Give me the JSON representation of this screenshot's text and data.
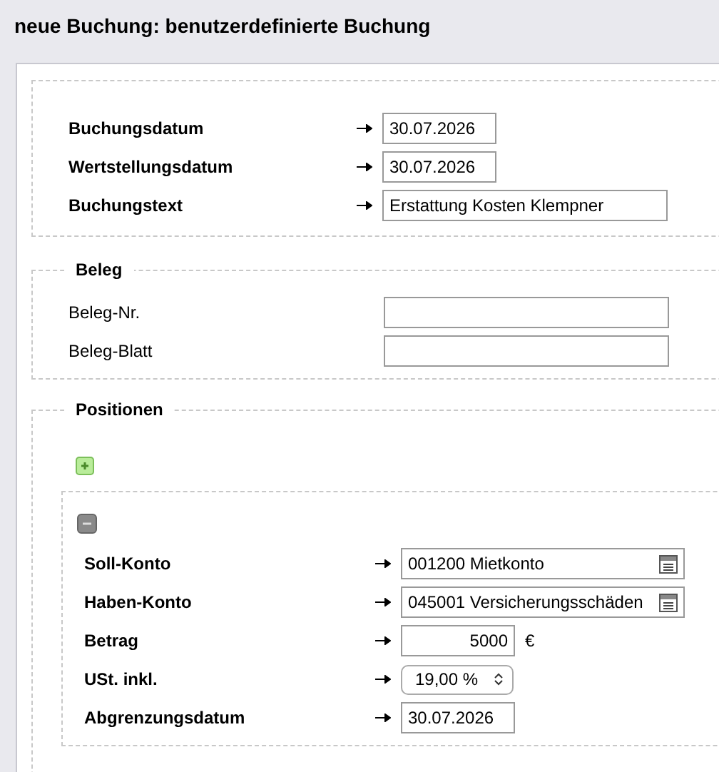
{
  "title": "neue Buchung: benutzerdefinierte Buchung",
  "main_fields": [
    {
      "label": "Buchungsdatum",
      "kind": "date",
      "required": true,
      "value": "30.07.2026"
    },
    {
      "label": "Wertstellungsdatum",
      "kind": "date",
      "required": true,
      "value": "30.07.2026"
    },
    {
      "label": "Buchungstext",
      "kind": "text",
      "required": true,
      "value": "Erstattung Kosten Klempner"
    }
  ],
  "beleg": {
    "legend": "Beleg",
    "fields": [
      {
        "label": "Beleg-Nr.",
        "kind": "text",
        "required": false
      },
      {
        "label": "Beleg-Blatt",
        "kind": "text",
        "required": false
      }
    ]
  },
  "positionen": {
    "legend": "Positionen",
    "positions": [
      {
        "fields": [
          {
            "label": "Soll-Konto",
            "kind": "lookup",
            "required": true,
            "value": "001200 Mietkonto"
          },
          {
            "label": "Haben-Konto",
            "kind": "lookup",
            "required": true,
            "value": "045001 Versicherungsschäden"
          },
          {
            "label": "Betrag",
            "kind": "amount",
            "required": true,
            "value": "5000",
            "unit": "€"
          },
          {
            "label": "USt. inkl.",
            "kind": "select",
            "required": true,
            "value": "19,00 %"
          },
          {
            "label": "Abgrenzungsdatum",
            "kind": "date",
            "required": true,
            "value": "30.07.2026"
          }
        ]
      }
    ]
  }
}
